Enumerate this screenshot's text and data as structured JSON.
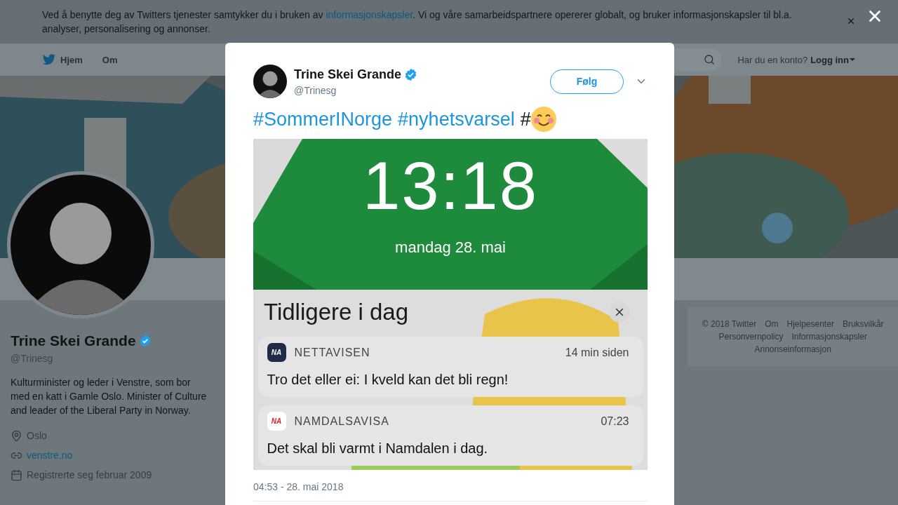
{
  "cookie_banner": {
    "text_before": "Ved å benytte deg av Twitters tjenester samtykker du i bruken av ",
    "link": "informasjonskapsler",
    "text_after": ". Vi og våre samarbeidspartnere opererer globalt, og bruker informasjonskapsler til bl.a. analyser, personalisering og annonser."
  },
  "nav": {
    "items": [
      {
        "label": "Hjem",
        "kind": "home"
      },
      {
        "label": "Om",
        "kind": "plain"
      }
    ],
    "account_prompt": "Har du en konto?",
    "login": "Logg inn"
  },
  "profile": {
    "name": "Trine Skei Grande",
    "verified": true,
    "handle": "@Trinesg",
    "bio": "Kulturminister og leder i Venstre, som bor med en katt i Gamle Oslo. Minister of Culture and leader of the Liberal Party in Norway.",
    "location": "Oslo",
    "website": "venstre.no",
    "joined": "Registrerte seg februar 2009"
  },
  "footer_links": [
    "© 2018 Twitter",
    "Om",
    "Hjelpesenter",
    "Bruksvilkår",
    "Personvernpolicy",
    "Informasjonskapsler",
    "Annonseinformasjon"
  ],
  "modal": {
    "author": {
      "name": "Trine Skei Grande",
      "verified": true,
      "handle": "@Trinesg"
    },
    "follow_button": "Følg",
    "tweet": [
      {
        "kind": "hashtag",
        "text": "#SommerINorge"
      },
      {
        "kind": "hashtag",
        "text": "#nyhetsvarsel"
      },
      {
        "kind": "text",
        "text": "#"
      },
      {
        "kind": "emoji"
      }
    ],
    "lock_screen": {
      "time": "13:18",
      "date": "mandag 28. mai",
      "section_title": "Tidligere i dag",
      "notifications": [
        {
          "app": "NETTAVISEN",
          "icon_label": "NA",
          "color": "#1f2a48",
          "time": "14 min siden",
          "message": "Tro det eller ei: I kveld kan det bli regn!"
        },
        {
          "app": "NAMDALSAVISA",
          "icon_label": "NA",
          "color": "#d8202c",
          "time": "07:23",
          "message": "Det skal bli varmt i Namdalen i dag."
        }
      ]
    },
    "timestamp": "04:53 - 28. mai 2018"
  }
}
